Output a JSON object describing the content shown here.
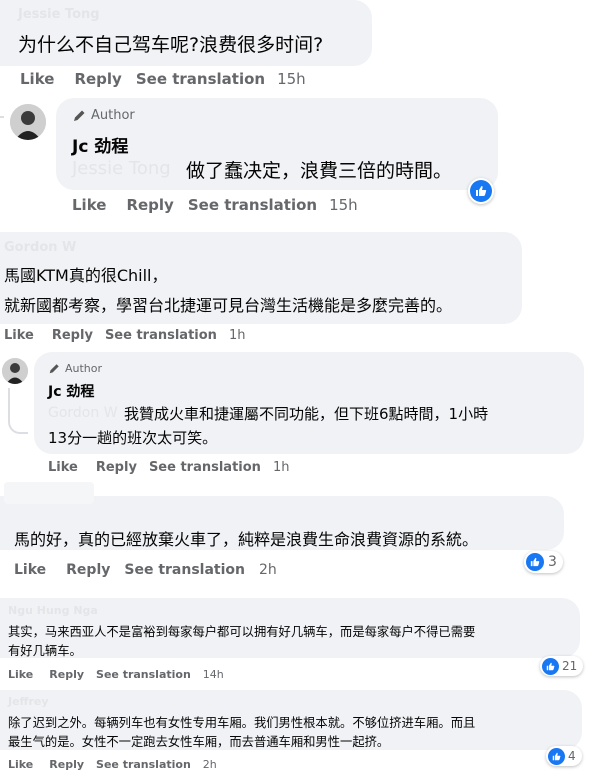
{
  "comments": [
    {
      "name": "Jessie Tong",
      "lines": [
        "为什么不自己驾车呢?浪费很多时间?"
      ],
      "actions": {
        "like": "Like",
        "reply": "Reply",
        "translate": "See translation",
        "time": "15h"
      }
    },
    {
      "author_badge": "Author",
      "name": "Jc 劲程",
      "mention": "Jessie Tong",
      "lines": [
        "做了蠢决定，浪費三倍的時間。"
      ],
      "actions": {
        "like": "Like",
        "reply": "Reply",
        "translate": "See translation",
        "time": "15h"
      },
      "reaction_icon": "like-icon"
    },
    {
      "name": "Gordon W",
      "lines": [
        "馬國KTM真的很Chill，",
        "就新國都考察，學習台北捷運可見台灣生活機能是多麼完善的。"
      ],
      "actions": {
        "like": "Like",
        "reply": "Reply",
        "translate": "See translation",
        "time": "1h"
      }
    },
    {
      "author_badge": "Author",
      "name": "Jc 劲程",
      "mention": "Gordon W",
      "lines": [
        "我贊成火車和捷運屬不同功能，但下班6點時間，1小時",
        "13分一趟的班次太可笑。"
      ],
      "actions": {
        "like": "Like",
        "reply": "Reply",
        "translate": "See translation",
        "time": "1h"
      }
    },
    {
      "name": "",
      "lines": [
        "馬的好，真的已經放棄火車了，純粹是浪費生命浪費資源的系統。"
      ],
      "actions": {
        "like": "Like",
        "reply": "Reply",
        "translate": "See translation",
        "time": "2h"
      },
      "reaction_count": "3"
    },
    {
      "name": "Ngu Hung Nga",
      "lines": [
        "其实，马来西亚人不是富裕到每家每户都可以拥有好几辆车，而是每家每户不得已需要",
        "有好几辆车。"
      ],
      "actions": {
        "like": "Like",
        "reply": "Reply",
        "translate": "See translation",
        "time": "14h"
      },
      "reaction_count": "21"
    },
    {
      "name": "Jeffrey",
      "lines": [
        "除了迟到之外。每辆列车也有女性专用车厢。我们男性根本就。不够位挤进车厢。而且",
        "最生气的是。女性不一定跑去女性车厢，而去普通车厢和男性一起挤。"
      ],
      "actions": {
        "like": "Like",
        "reply": "Reply",
        "translate": "See translation",
        "time": "2h"
      },
      "reaction_count": "4"
    }
  ],
  "colors": {
    "bubble": "#f0f2f5",
    "meta": "#65676b",
    "like_blue": "#1877f2",
    "text": "#050505"
  }
}
